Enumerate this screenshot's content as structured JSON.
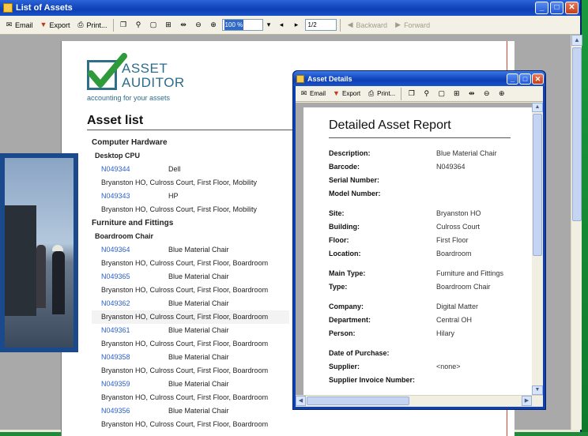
{
  "main_window": {
    "title": "List of Assets",
    "toolbar": {
      "email": "Email",
      "export": "Export",
      "print": "Print...",
      "zoom": "100 %",
      "page": "1/2",
      "backward": "Backward",
      "forward": "Forward"
    }
  },
  "logo": {
    "line1": "ASSET",
    "line2": "AUDITOR",
    "tagline": "accounting for your assets"
  },
  "asset_list": {
    "title": "Asset list",
    "rows": [
      {
        "kind": "cat",
        "text": "Computer Hardware"
      },
      {
        "kind": "sub",
        "text": "Desktop CPU"
      },
      {
        "kind": "item",
        "code": "N049344",
        "name": "Dell"
      },
      {
        "kind": "loc",
        "text": "Bryanston HO, Culross Court, First Floor, Mobility"
      },
      {
        "kind": "item",
        "code": "N049343",
        "name": "HP"
      },
      {
        "kind": "loc",
        "text": "Bryanston HO, Culross Court, First Floor, Mobility"
      },
      {
        "kind": "cat",
        "text": "Furniture and Fittings"
      },
      {
        "kind": "sub",
        "text": "Boardroom Chair"
      },
      {
        "kind": "item",
        "code": "N049364",
        "name": "Blue Material Chair"
      },
      {
        "kind": "loc",
        "text": "Bryanston HO, Culross Court, First Floor, Boardroom"
      },
      {
        "kind": "item",
        "code": "N049365",
        "name": "Blue Material Chair"
      },
      {
        "kind": "loc",
        "text": "Bryanston HO, Culross Court, First Floor, Boardroom"
      },
      {
        "kind": "item",
        "code": "N049362",
        "name": "Blue Material Chair"
      },
      {
        "kind": "loc",
        "text": "Bryanston HO, Culross Court, First Floor, Boardroom",
        "shade": true
      },
      {
        "kind": "item",
        "code": "N049361",
        "name": "Blue Material Chair"
      },
      {
        "kind": "loc",
        "text": "Bryanston HO, Culross Court, First Floor, Boardroom"
      },
      {
        "kind": "item",
        "code": "N049358",
        "name": "Blue Material Chair"
      },
      {
        "kind": "loc",
        "text": "Bryanston HO, Culross Court, First Floor, Boardroom"
      },
      {
        "kind": "item",
        "code": "N049359",
        "name": "Blue Material Chair"
      },
      {
        "kind": "loc",
        "text": "Bryanston HO, Culross Court, First Floor, Boardroom"
      },
      {
        "kind": "item",
        "code": "N049356",
        "name": "Blue Material Chair"
      },
      {
        "kind": "loc",
        "text": "Bryanston HO, Culross Court, First Floor, Boardroom"
      }
    ]
  },
  "detail_window": {
    "title": "Asset Details",
    "toolbar": {
      "email": "Email",
      "export": "Export",
      "print": "Print..."
    },
    "report_title": "Detailed Asset Report",
    "fields": [
      {
        "label": "Description:",
        "value": "Blue Material Chair"
      },
      {
        "label": "Barcode:",
        "value": "N049364"
      },
      {
        "label": "Serial Number:",
        "value": ""
      },
      {
        "label": "Model Number:",
        "value": ""
      },
      {
        "label": "Site:",
        "value": "Bryanston HO",
        "gap": true
      },
      {
        "label": "Building:",
        "value": "Culross Court"
      },
      {
        "label": "Floor:",
        "value": "First Floor"
      },
      {
        "label": "Location:",
        "value": "Boardroom"
      },
      {
        "label": "Main Type:",
        "value": "Furniture and Fittings",
        "gap": true
      },
      {
        "label": "Type:",
        "value": "Boardroom Chair"
      },
      {
        "label": "Company:",
        "value": "Digital Matter",
        "gap": true
      },
      {
        "label": "Department:",
        "value": "Central OH"
      },
      {
        "label": "Person:",
        "value": "Hilary"
      },
      {
        "label": "Date of Purchase:",
        "value": "",
        "gap": true
      },
      {
        "label": "Supplier:",
        "value": "<none>"
      },
      {
        "label": "Supplier Invoice Number:",
        "value": ""
      }
    ]
  }
}
